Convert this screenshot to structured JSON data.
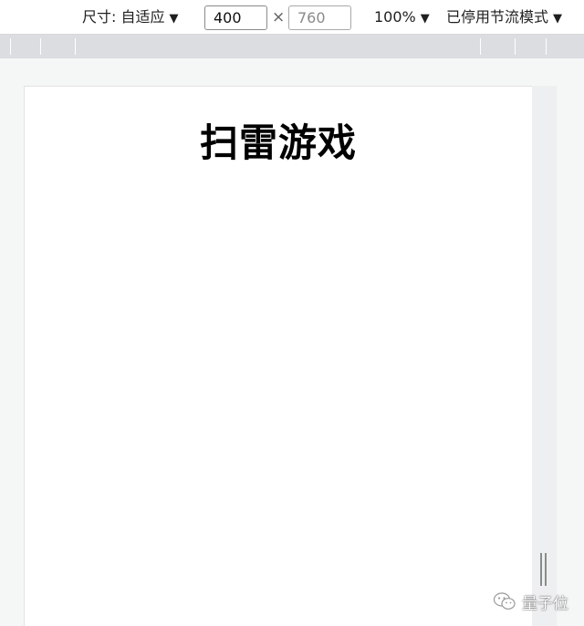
{
  "toolbar": {
    "size_label": "尺寸: 自适应",
    "width_value": "400",
    "height_value": "760",
    "times_symbol": "×",
    "zoom_label": "100%",
    "throttle_label": "已停用节流模式",
    "caret_symbol": "▼"
  },
  "page": {
    "title": "扫雷游戏"
  },
  "watermark": {
    "text": "量子位",
    "icon": "wechat-icon"
  }
}
